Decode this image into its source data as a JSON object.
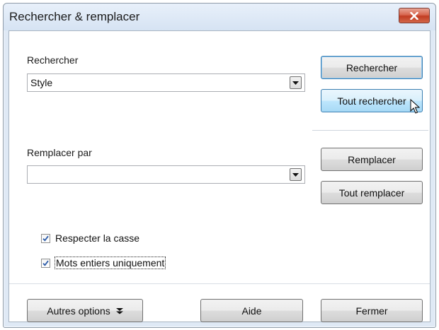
{
  "window": {
    "title": "Rechercher & remplacer"
  },
  "search": {
    "label": "Rechercher",
    "value": "Style",
    "find_button": "Rechercher",
    "find_all_button": "Tout rechercher"
  },
  "replace": {
    "label": "Remplacer par",
    "value": "",
    "replace_button": "Remplacer",
    "replace_all_button": "Tout remplacer"
  },
  "options": {
    "match_case": {
      "label": "Respecter la casse",
      "checked": true
    },
    "whole_words": {
      "label": "Mots entiers uniquement",
      "checked": true
    }
  },
  "footer": {
    "more_options": "Autres options",
    "help": "Aide",
    "close": "Fermer"
  },
  "colors": {
    "close_button": "#c13d22",
    "default_button_border": "#3c7fb1",
    "checkbox_check": "#2a5aa8"
  }
}
